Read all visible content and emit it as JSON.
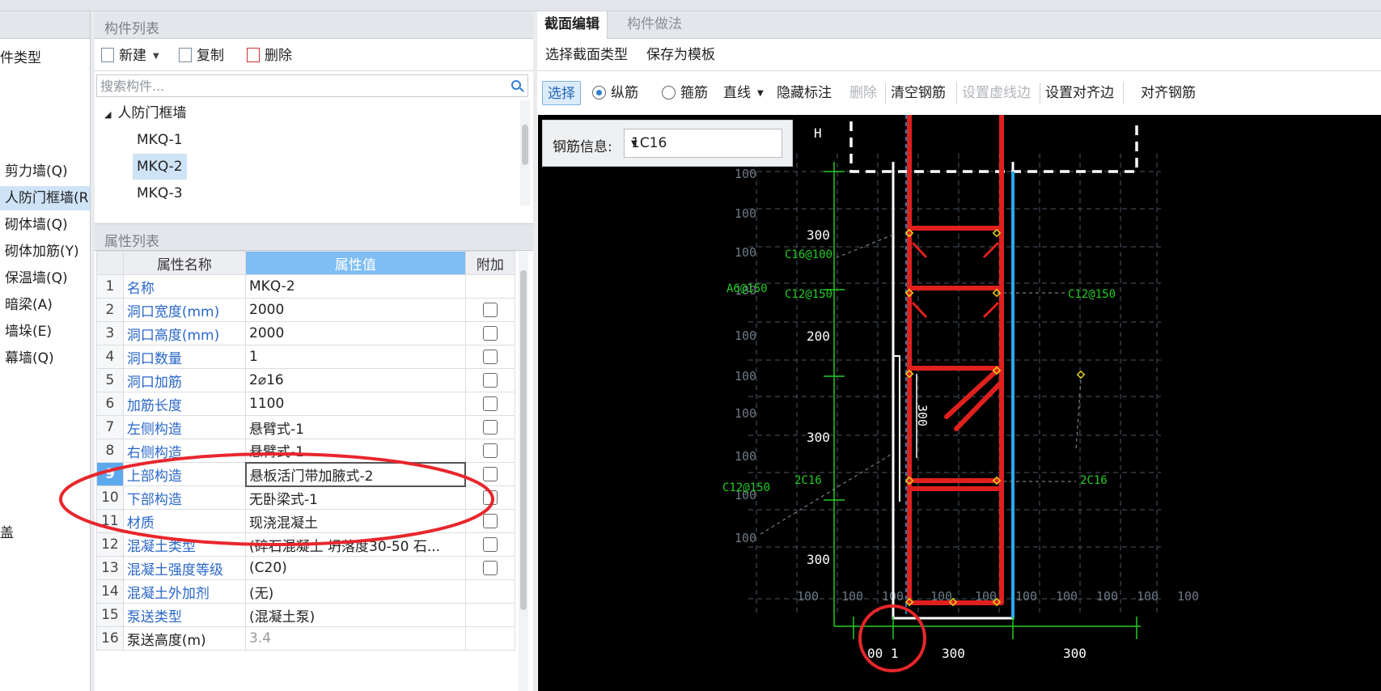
{
  "left_panel": {
    "title": "件类型",
    "items": [
      "剪力墙(Q)",
      "人防门框墙(R",
      "砌体墙(Q)",
      "砌体加筋(Y)",
      "保温墙(Q)",
      "暗梁(A)",
      "墙垛(E)",
      "幕墙(Q)"
    ],
    "bottom": "盖"
  },
  "component_list": {
    "title": "构件列表",
    "toolbar": {
      "new": "新建",
      "copy": "复制",
      "delete": "删除"
    },
    "search_placeholder": "搜索构件...",
    "group": "人防门框墙",
    "items": [
      "MKQ-1",
      "MKQ-2",
      "MKQ-3"
    ],
    "selected": "MKQ-2"
  },
  "property_list": {
    "title": "属性列表",
    "headers": [
      "属性名称",
      "属性值",
      "附加"
    ],
    "rows": [
      {
        "n": "1",
        "name": "名称",
        "value": "MKQ-2",
        "check": false
      },
      {
        "n": "2",
        "name": "洞口宽度(mm)",
        "value": "2000",
        "check": true
      },
      {
        "n": "3",
        "name": "洞口高度(mm)",
        "value": "2000",
        "check": true
      },
      {
        "n": "4",
        "name": "洞口数量",
        "value": "1",
        "check": true
      },
      {
        "n": "5",
        "name": "洞口加筋",
        "value": "2⌀16",
        "check": true
      },
      {
        "n": "6",
        "name": "加筋长度",
        "value": "1100",
        "check": true
      },
      {
        "n": "7",
        "name": "左侧构造",
        "value": "悬臂式-1",
        "check": true
      },
      {
        "n": "8",
        "name": "右侧构造",
        "value": "悬臂式-1",
        "check": true
      },
      {
        "n": "9",
        "name": "上部构造",
        "value": "悬板活门带加腋式-2",
        "check": true
      },
      {
        "n": "10",
        "name": "下部构造",
        "value": "无卧梁式-1",
        "check": true
      },
      {
        "n": "11",
        "name": "材质",
        "value": "现浇混凝土",
        "check": true
      },
      {
        "n": "12",
        "name": "混凝土类型",
        "value": "(碎石混凝土 坍落度30-50 石...",
        "check": true
      },
      {
        "n": "13",
        "name": "混凝土强度等级",
        "value": "(C20)",
        "check": true
      },
      {
        "n": "14",
        "name": "混凝土外加剂",
        "value": "(无)",
        "check": false
      },
      {
        "n": "15",
        "name": "泵送类型",
        "value": "(混凝土泵)",
        "check": false
      },
      {
        "n": "16",
        "name": "泵送高度(m)",
        "value": "3.4",
        "check": false
      }
    ]
  },
  "right_panel": {
    "tabs": [
      "截面编辑",
      "构件做法"
    ],
    "toolbar1": [
      "选择截面类型",
      "保存为模板"
    ],
    "toolbar2": {
      "select": "选择",
      "longitudinal": "纵筋",
      "stirrup": "箍筋",
      "line": "直线",
      "hide_mark": "隐藏标注",
      "delete": "删除",
      "clear_rebar": "清空钢筋",
      "set_dashed_edge": "设置虚线边",
      "set_align_edge": "设置对齐边",
      "align_rebar": "对齐钢筋"
    },
    "rebar_info_label": "钢筋信息:",
    "rebar_info_value": "1C16"
  },
  "drawing": {
    "label_h": "H",
    "grid_100": "100",
    "dims_left": [
      "300",
      "200",
      "300",
      "300"
    ],
    "rebar_labels": {
      "c16_100": "C16@100",
      "a6_150": "A6@150",
      "c12_150": "C12@150",
      "c16_2": "2C16"
    },
    "inner_dim": "300",
    "bottom_row": [
      "100",
      "100",
      "100",
      "100",
      "100",
      "100",
      "100",
      "100",
      "100",
      "100"
    ],
    "bottom_dims": [
      "00 1",
      "300",
      "300"
    ],
    "colors": {
      "rebar": "#e0201e",
      "edge_blue": "#2aa9ee",
      "dim_green": "#22cc22",
      "grid": "#4d5966",
      "highlight": "#e8262c"
    }
  }
}
